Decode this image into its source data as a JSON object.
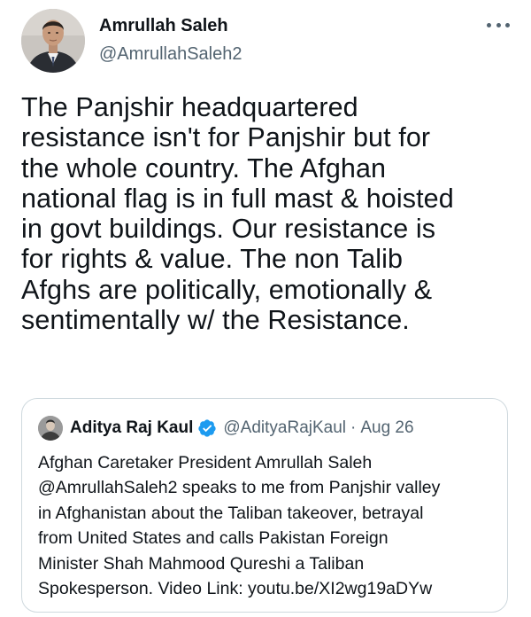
{
  "author": {
    "display_name": "Amrullah Saleh",
    "handle": "@AmrullahSaleh2"
  },
  "more_icon": "more-horizontal-icon",
  "tweet_lines": [
    "The Panjshir headquartered",
    "resistance isn't for Panjshir but for",
    "the whole country. The Afghan",
    "national flag is in full mast & hoisted",
    "in govt buildings. Our resistance is",
    "for rights & value. The non Talib",
    "Afghs are politically, emotionally &",
    "sentimentally w/ the Resistance."
  ],
  "quoted_tweet": {
    "display_name": "Aditya Raj Kaul",
    "verified_icon": "verified-badge-icon",
    "handle": "@AdityaRajKaul",
    "separator": "·",
    "date": "Aug 26",
    "lines": [
      "Afghan Caretaker President Amrullah Saleh",
      "@AmrullahSaleh2 speaks to me from Panjshir valley",
      "in Afghanistan about the Taliban takeover, betrayal",
      "from United States and calls Pakistan Foreign",
      "Minister Shah Mahmood Qureshi a Taliban",
      "Spokesperson. Video Link: youtu.be/XI2wg19aDYw"
    ]
  },
  "colors": {
    "text": "#0f1419",
    "secondary": "#536471",
    "border": "#cfd9de",
    "verified": "#1d9bf0"
  }
}
